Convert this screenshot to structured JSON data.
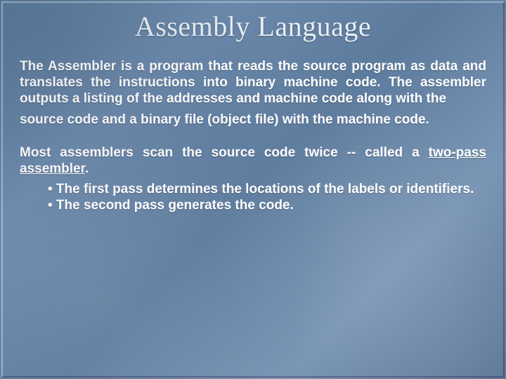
{
  "title": "Assembly Language",
  "para1a": "The Assembler is a program that reads the source program as data and translates the instructions into binary machine code.  The assembler outputs a listing of the addresses and machine code along with the",
  "para1b": "source code and a binary file (object file) with the machine code.",
  "para2_lead": "Most assemblers scan the source code twice -- called a ",
  "para2_underlined": "two-pass assembler",
  "para2_tail": ".",
  "bullet1": "• The first pass determines the locations of the labels or identifiers.",
  "bullet2": "• The second pass generates the code."
}
